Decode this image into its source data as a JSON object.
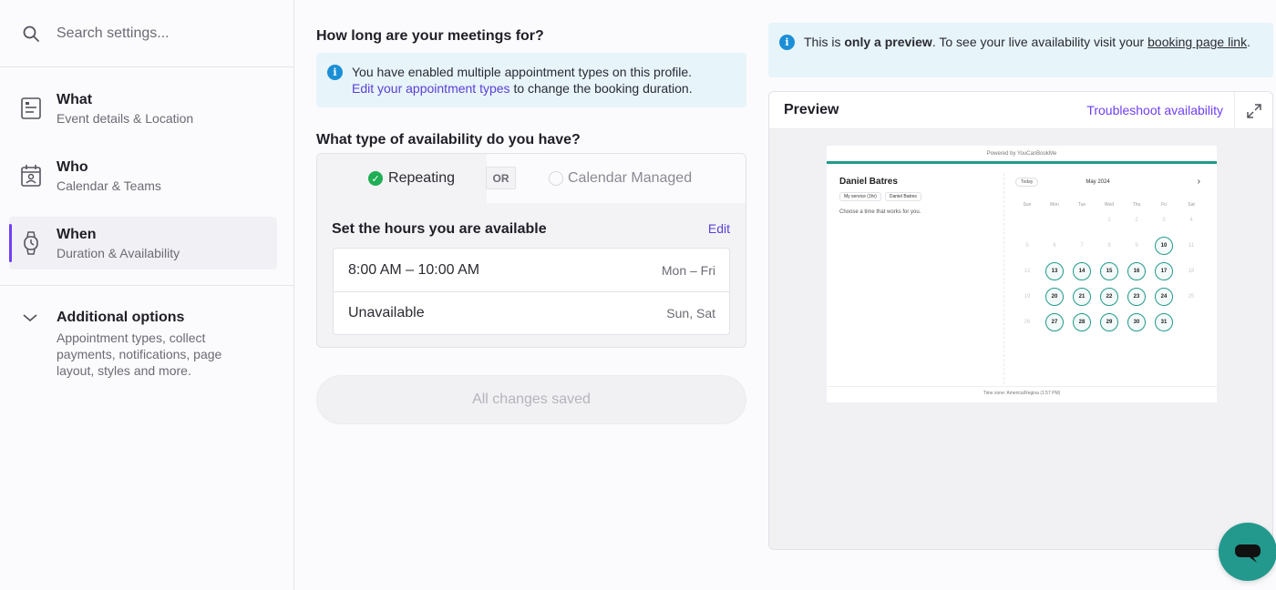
{
  "search": {
    "placeholder": "Search settings..."
  },
  "sidebar": {
    "items": [
      {
        "title": "What",
        "subtitle": "Event details & Location"
      },
      {
        "title": "Who",
        "subtitle": "Calendar & Teams"
      },
      {
        "title": "When",
        "subtitle": "Duration & Availability"
      }
    ],
    "additional": {
      "title": "Additional options",
      "subtitle": "Appointment types, collect payments, notifications, page layout, styles and more."
    }
  },
  "main": {
    "meetings_heading": "How long are your meetings for?",
    "info_text": "You have enabled multiple appointment types on this profile.",
    "info_link": "Edit your appointment types",
    "info_suffix": "to change the booking duration.",
    "availability_heading": "What type of availability do you have?",
    "option_repeating": "Repeating",
    "or_label": "OR",
    "option_calendar": "Calendar Managed",
    "hours_heading": "Set the hours you are available",
    "edit_label": "Edit",
    "hours": [
      {
        "time": "8:00 AM – 10:00 AM",
        "days": "Mon – Fri"
      },
      {
        "time": "Unavailable",
        "days": "Sun, Sat"
      }
    ],
    "save_label": "All changes saved"
  },
  "preview_info": {
    "prefix": "This is",
    "bold": "only a preview",
    "middle": ". To see your live availability visit your",
    "link": "booking page link",
    "suffix": "."
  },
  "preview": {
    "title": "Preview",
    "troubleshoot": "Troubleshoot availability",
    "mini": {
      "powered": "Powered by YouCanBookMe",
      "name": "Daniel Batres",
      "service_tag": "My service (1hr)",
      "person_tag": "Daniel Batres",
      "choose": "Choose a time that works for you.",
      "today": "Today",
      "month": "May 2024",
      "dow": [
        "Sun",
        "Mon",
        "Tue",
        "Wed",
        "Thu",
        "Fri",
        "Sat"
      ],
      "weeks": [
        [
          [
            "",
            false
          ],
          [
            "",
            false
          ],
          [
            "",
            false
          ],
          [
            "1",
            false
          ],
          [
            "2",
            false
          ],
          [
            "3",
            false
          ],
          [
            "4",
            false
          ]
        ],
        [
          [
            "5",
            false
          ],
          [
            "6",
            false
          ],
          [
            "7",
            false
          ],
          [
            "8",
            false
          ],
          [
            "9",
            false
          ],
          [
            "10",
            true
          ],
          [
            "11",
            false
          ]
        ],
        [
          [
            "12",
            false
          ],
          [
            "13",
            true
          ],
          [
            "14",
            true
          ],
          [
            "15",
            true
          ],
          [
            "16",
            true
          ],
          [
            "17",
            true
          ],
          [
            "18",
            false
          ]
        ],
        [
          [
            "19",
            false
          ],
          [
            "20",
            true
          ],
          [
            "21",
            true
          ],
          [
            "22",
            true
          ],
          [
            "23",
            true
          ],
          [
            "24",
            true
          ],
          [
            "25",
            false
          ]
        ],
        [
          [
            "26",
            false
          ],
          [
            "27",
            true
          ],
          [
            "28",
            true
          ],
          [
            "29",
            true
          ],
          [
            "30",
            true
          ],
          [
            "31",
            true
          ],
          [
            "",
            false
          ]
        ]
      ],
      "timezone_label": "Time zone:",
      "timezone": "America/Regina (1:57 PM)"
    }
  },
  "colors": {
    "accent": "#6f3ff5",
    "teal": "#23998e",
    "info_bg": "#e7f4fa"
  }
}
